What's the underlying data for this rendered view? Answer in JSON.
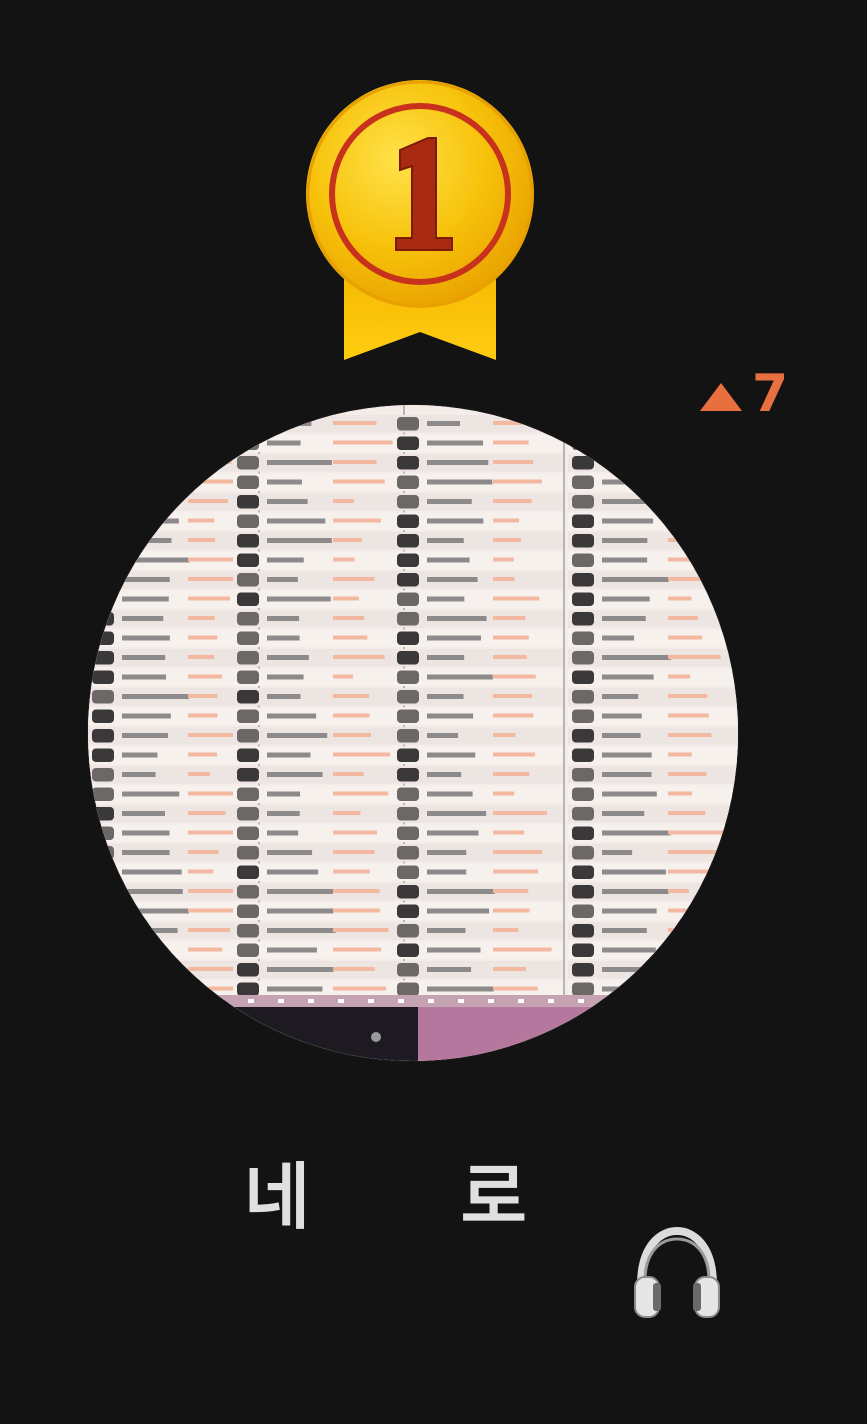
{
  "ranking": {
    "rank": "1",
    "change_arrow_icon": "triangle-up-icon",
    "change_value": "7",
    "accent_color": "#e8703f",
    "medal_icon": "gold-medal-icon"
  },
  "user": {
    "display_name": "네      로",
    "name_suffix_icon": "headphones-icon"
  },
  "colors": {
    "background": "#131313",
    "medal_gold": "#f2b600",
    "medal_ring": "#c8321c",
    "text": "#e0e0e0"
  }
}
